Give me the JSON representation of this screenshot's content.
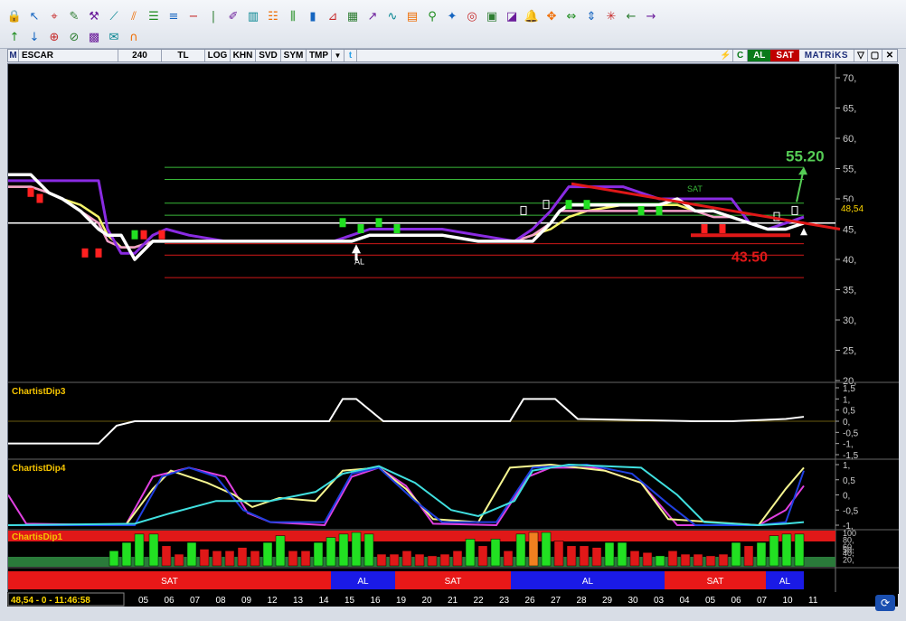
{
  "toolbar": {
    "row1_icons": [
      "lock-icon",
      "pointer-icon",
      "crosshair-icon",
      "pencil-icon",
      "tools-icon",
      "trendline-icon",
      "channel-icon",
      "hline-icon",
      "hline2-icon",
      "minus-icon",
      "vline-icon",
      "brush-icon",
      "pattern-icon",
      "fib-icon",
      "chart-icon",
      "candle-icon",
      "gann-icon",
      "grid-icon",
      "arrow-icon",
      "wave-icon",
      "table-icon",
      "magnet-icon",
      "star-icon",
      "cycle-icon",
      "layout-icon",
      "layout2-icon",
      "bell-icon",
      "crossarrows-icon",
      "expand-icon",
      "updown-icon",
      "dot-icon",
      "left-icon",
      "right-icon"
    ],
    "row2_icons": [
      "arrow-up-icon",
      "arrow-down-icon",
      "zoom-icon",
      "reset-icon",
      "image-icon",
      "mail-icon",
      "magnet2-icon"
    ]
  },
  "symbar": {
    "m_label": "M",
    "symbol": "ESCAR",
    "period": "240",
    "currency": "TL",
    "log": "LOG",
    "khn": "KHN",
    "svd": "SVD",
    "sym": "SYM",
    "tmp": "TMP",
    "al": "AL",
    "sat": "SAT",
    "brand": "MATRiKS"
  },
  "colors": {
    "buy": "#22e022",
    "sell": "#ff2020",
    "purple": "#8a2be2",
    "white": "#ffffff",
    "pink": "#f2a0c8",
    "yellow": "#f5f56a"
  },
  "main_chart": {
    "y_ticks": [
      "70,",
      "65,",
      "60,",
      "55,",
      "50,",
      "45,",
      "40,",
      "35,",
      "30,",
      "25,",
      "20,"
    ],
    "last_price": "48,54",
    "target_up": "55.20",
    "target_down": "43.50",
    "sat_label": "SAT",
    "al_label": "AL"
  },
  "panel_dip3": {
    "title": "ChartistDip3",
    "y_ticks": [
      "1,5",
      "1,",
      "0,5",
      "0,",
      "-0,5",
      "-1,",
      "-1,5"
    ]
  },
  "panel_dip4": {
    "title": "ChartistDip4",
    "y_ticks": [
      "1,",
      "0,5",
      "0,",
      "-0,5",
      "-1,"
    ]
  },
  "panel_dip1": {
    "title": "ChartisDip1",
    "y_ticks": [
      "100",
      "80,",
      "60,",
      "50,",
      "40,",
      "20,"
    ]
  },
  "signal_bar": [
    {
      "label": "SAT",
      "type": "sell"
    },
    {
      "label": "AL",
      "type": "buy"
    },
    {
      "label": "SAT",
      "type": "sell"
    },
    {
      "label": "AL",
      "type": "buy"
    },
    {
      "label": "SAT",
      "type": "sell"
    },
    {
      "label": "AL",
      "type": "buy"
    }
  ],
  "status": {
    "readout": "48,54 - 0 - 11:46:58",
    "dates": [
      "05",
      "06",
      "07",
      "08",
      "09",
      "12",
      "13",
      "14",
      "15",
      "16",
      "19",
      "20",
      "21",
      "22",
      "23",
      "26",
      "27",
      "28",
      "29",
      "30",
      "03",
      "04",
      "05",
      "06",
      "07",
      "10",
      "11"
    ]
  }
}
